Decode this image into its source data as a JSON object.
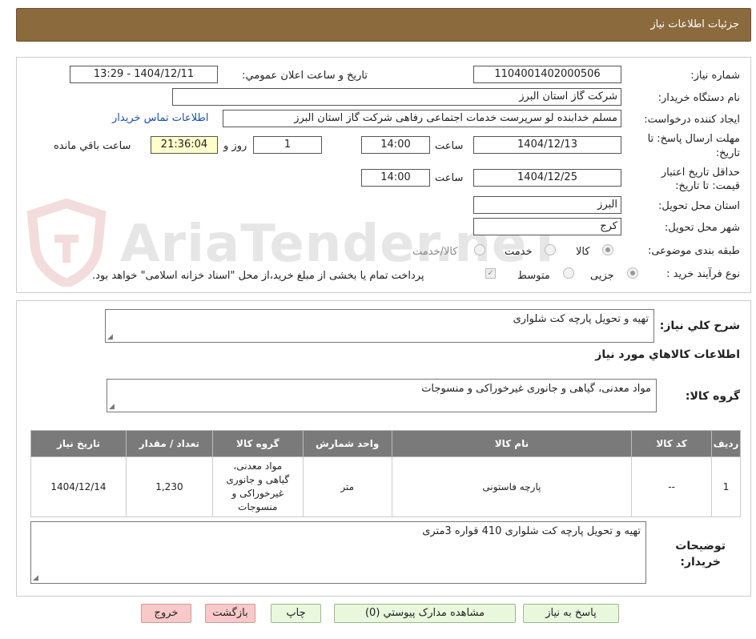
{
  "page_title": "جزئیات اطلاعات نیاز",
  "watermark": "AriaTender.neT",
  "need_number": {
    "label": "شماره نیاز:",
    "value": "1104001402000506"
  },
  "announce_datetime": {
    "label": "تاریخ و ساعت اعلان عمومي:",
    "value": "1404/12/11 - 13:29"
  },
  "buyer_org": {
    "label": "نام دستگاه خريدار:",
    "value": "شرکت گاز استان البرز"
  },
  "requester": {
    "label": "ايجاد کننده درخواست:",
    "value": "مسلم خدابنده لو سرپرست خدمات اجتماعی رفاهی شرکت گاز استان البرز",
    "contact_link": "اطلاعات تماس خریدار"
  },
  "reply_deadline": {
    "label_line1": "مهلت ارسال پاسخ: تا",
    "label_line2": "تاریخ:",
    "date": "1404/12/13",
    "time_label": "ساعت",
    "time": "14:00",
    "days": "1",
    "days_label": "روز و",
    "countdown": "21:36:04",
    "remaining_label": "ساعت باقي مانده"
  },
  "price_validity": {
    "label_line1": "حداقل تاريخ اعتبار",
    "label_line2": "قیمت: تا تاریخ:",
    "date": "1404/12/25",
    "time_label": "ساعت",
    "time": "14:00"
  },
  "delivery_province": {
    "label": "استان محل تحويل:",
    "value": "البرز"
  },
  "delivery_city": {
    "label": "شهر محل تحويل:",
    "value": "کرج"
  },
  "category": {
    "label": "طبقه بندی موضوعی:",
    "options": [
      "کالا",
      "خدمت",
      "کالا/خدمت"
    ],
    "selected": 0
  },
  "purchase_process": {
    "label": "نوع فرآیند خرید :",
    "options": [
      "جزیی",
      "متوسط"
    ],
    "selected": 0,
    "note": "پرداخت تمام یا بخشی از مبلغ خرید،از محل \"اسناد خزانه اسلامی\" خواهد بود."
  },
  "general_desc": {
    "label": "شرح کلي نياز:",
    "value": "تهیه و تحویل پارچه کت شلواری"
  },
  "goods_info_heading": "اطلاعات کالاهاي مورد نياز",
  "goods_group": {
    "label": "گروه کالا:",
    "value": "مواد معدنی، گیاهی و جانوری غیرخوراکی و منسوجات"
  },
  "table": {
    "headers": [
      "رديف",
      "کد کالا",
      "نام کالا",
      "واحد شمارش",
      "گروه کالا",
      "تعداد / مقدار",
      "تاريخ نياز"
    ],
    "rows": [
      {
        "row": "1",
        "code": "--",
        "name": "پارچه فاستونی",
        "unit": "متر",
        "group": "مواد معدنی، گیاهی و جانوری غیرخوراکی و منسوجات",
        "qty": "1,230",
        "date": "1404/12/14"
      }
    ]
  },
  "buyer_notes": {
    "label_line1": "توضيحات",
    "label_line2": "خريدار:",
    "value": "تهیه و تحویل پارچه کت شلواری 410 قواره 3متری"
  },
  "buttons": {
    "reply": "پاسخ به نياز",
    "attachments": "مشاهده مدارک پيوستي (0)",
    "print": "چاپ",
    "back": "بازگشت",
    "exit": "خروج"
  },
  "colors": {
    "header_bg": "#8b6a3e",
    "table_header_bg": "#7a7a7a",
    "button_green": "#e9f7dc",
    "button_pink": "#f9c9c9",
    "countdown_bg": "#ffffcc",
    "link": "#1a4fa8"
  }
}
